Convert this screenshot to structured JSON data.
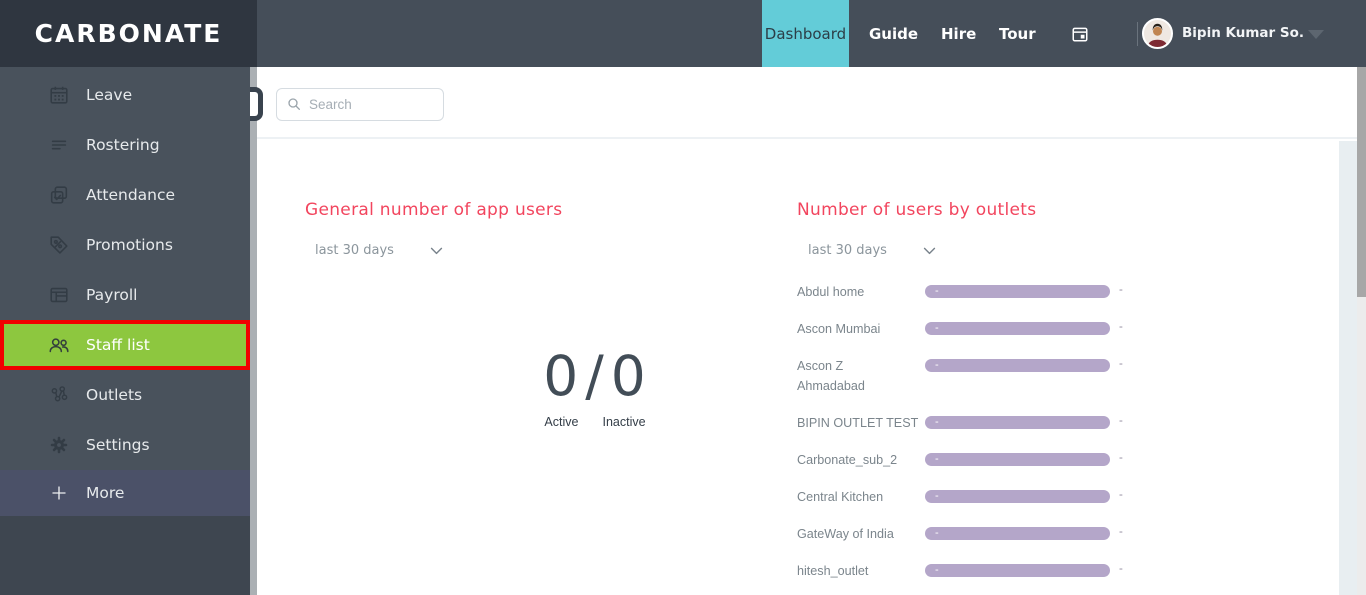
{
  "colors": {
    "header_bg": "#454e59",
    "logo_bg": "#2f3640",
    "sidebar_bg": "#49525c",
    "active_tab_teal": "#63ccd8",
    "staff_list_green": "#8dc73f",
    "annotation_red": "#f10000",
    "more_row_bg": "#4b5168",
    "panel_title_red": "#f2455e",
    "bar_purple": "#b4a6c9"
  },
  "header": {
    "logo": "CARBONATE",
    "nav": [
      {
        "label": "Dashboard",
        "active": true
      },
      {
        "label": "Guide",
        "active": false
      },
      {
        "label": "Hire",
        "active": false
      },
      {
        "label": "Tour",
        "active": false
      }
    ],
    "user": {
      "name": "Bipin Kumar So..."
    }
  },
  "sidebar": {
    "items": [
      {
        "label": "Leave",
        "icon": "calendar-icon"
      },
      {
        "label": "Rostering",
        "icon": "rostering-icon"
      },
      {
        "label": "Attendance",
        "icon": "attendance-icon"
      },
      {
        "label": "Promotions",
        "icon": "promotions-icon"
      },
      {
        "label": "Payroll",
        "icon": "payroll-icon"
      },
      {
        "label": "Staff list",
        "icon": "staff-icon",
        "active": true
      },
      {
        "label": "Outlets",
        "icon": "outlets-icon"
      },
      {
        "label": "Settings",
        "icon": "settings-icon"
      },
      {
        "label": "More",
        "icon": "plus-icon"
      }
    ]
  },
  "search": {
    "placeholder": "Search"
  },
  "main": {
    "app_users_panel": {
      "title": "General number of app users",
      "filter": "last 30 days",
      "active_count": "0",
      "separator": "/",
      "inactive_count": "0",
      "active_label": "Active",
      "inactive_label": "Inactive"
    },
    "outlets_panel": {
      "title": "Number of users by outlets",
      "filter": "last 30 days",
      "rows": [
        {
          "name": "Abdul home",
          "bar_label": "-",
          "value": "-"
        },
        {
          "name": "Ascon Mumbai",
          "bar_label": "-",
          "value": "-"
        },
        {
          "name": "Ascon Z\nAhmadabad",
          "bar_label": "-",
          "value": "-"
        },
        {
          "name": "BIPIN OUTLET TEST",
          "bar_label": "-",
          "value": "-"
        },
        {
          "name": "Carbonate_sub_2",
          "bar_label": "-",
          "value": "-"
        },
        {
          "name": "Central Kitchen",
          "bar_label": "-",
          "value": "-"
        },
        {
          "name": "GateWay of India",
          "bar_label": "-",
          "value": "-"
        },
        {
          "name": "hitesh_outlet",
          "bar_label": "-",
          "value": "-"
        }
      ]
    }
  }
}
